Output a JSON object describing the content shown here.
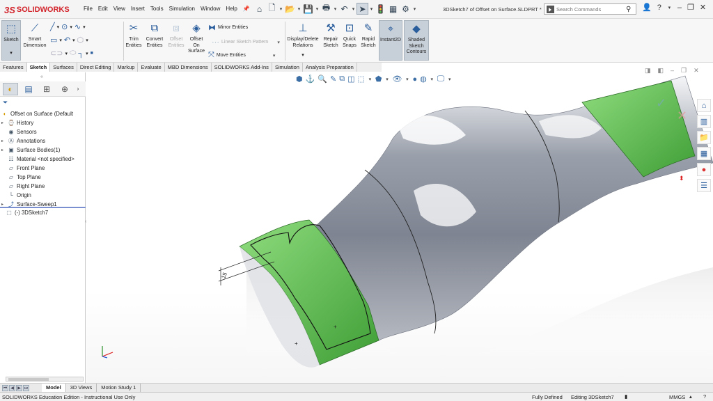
{
  "app": {
    "name": "SOLIDWORKS",
    "logo_prefix": "3S",
    "document_title": "3DSketch7 of Offset on Surface.SLDPRT *"
  },
  "menu": [
    "File",
    "Edit",
    "View",
    "Insert",
    "Tools",
    "Simulation",
    "Window",
    "Help"
  ],
  "search": {
    "placeholder": "Search Commands"
  },
  "ribbon": {
    "sketch": "Sketch",
    "smart_dimension": [
      "Smart",
      "Dimension"
    ],
    "trim": [
      "Trim",
      "Entities"
    ],
    "convert": [
      "Convert",
      "Entities"
    ],
    "offset_entities": [
      "Offset",
      "Entities"
    ],
    "offset_on_surface": [
      "Offset",
      "On",
      "Surface"
    ],
    "mirror": "Mirror Entities",
    "linear_pattern": "Linear Sketch Pattern",
    "move": "Move Entities",
    "display_delete": [
      "Display/Delete",
      "Relations"
    ],
    "repair": [
      "Repair",
      "Sketch"
    ],
    "quick_snaps": [
      "Quick",
      "Snaps"
    ],
    "rapid_sketch": [
      "Rapid",
      "Sketch"
    ],
    "instant2d": "Instant2D",
    "shaded": [
      "Shaded",
      "Sketch",
      "Contours"
    ]
  },
  "tabs": [
    "Features",
    "Sketch",
    "Surfaces",
    "Direct Editing",
    "Markup",
    "Evaluate",
    "MBD Dimensions",
    "SOLIDWORKS Add-Ins",
    "Simulation",
    "Analysis Preparation"
  ],
  "active_tab": "Sketch",
  "tree": {
    "root": "Offset on Surface  (Default",
    "items": [
      "History",
      "Sensors",
      "Annotations",
      "Surface Bodies(1)",
      "Material <not specified>",
      "Front Plane",
      "Top Plane",
      "Right Plane",
      "Origin",
      "Surface-Sweep1",
      "(-) 3DSketch7"
    ]
  },
  "dimension_label": "15",
  "bottom_tabs": [
    "Model",
    "3D Views",
    "Motion Study 1"
  ],
  "status": {
    "left": "SOLIDWORKS Education Edition - Instructional Use Only",
    "fully_defined": "Fully Defined",
    "editing": "Editing 3DSketch7",
    "units": "MMGS"
  },
  "colors": {
    "accent_red": "#d2232a",
    "surface_green": "#4fb043",
    "body_gray": "#8e939f",
    "ribbon_blue": "#2a5d9c"
  }
}
